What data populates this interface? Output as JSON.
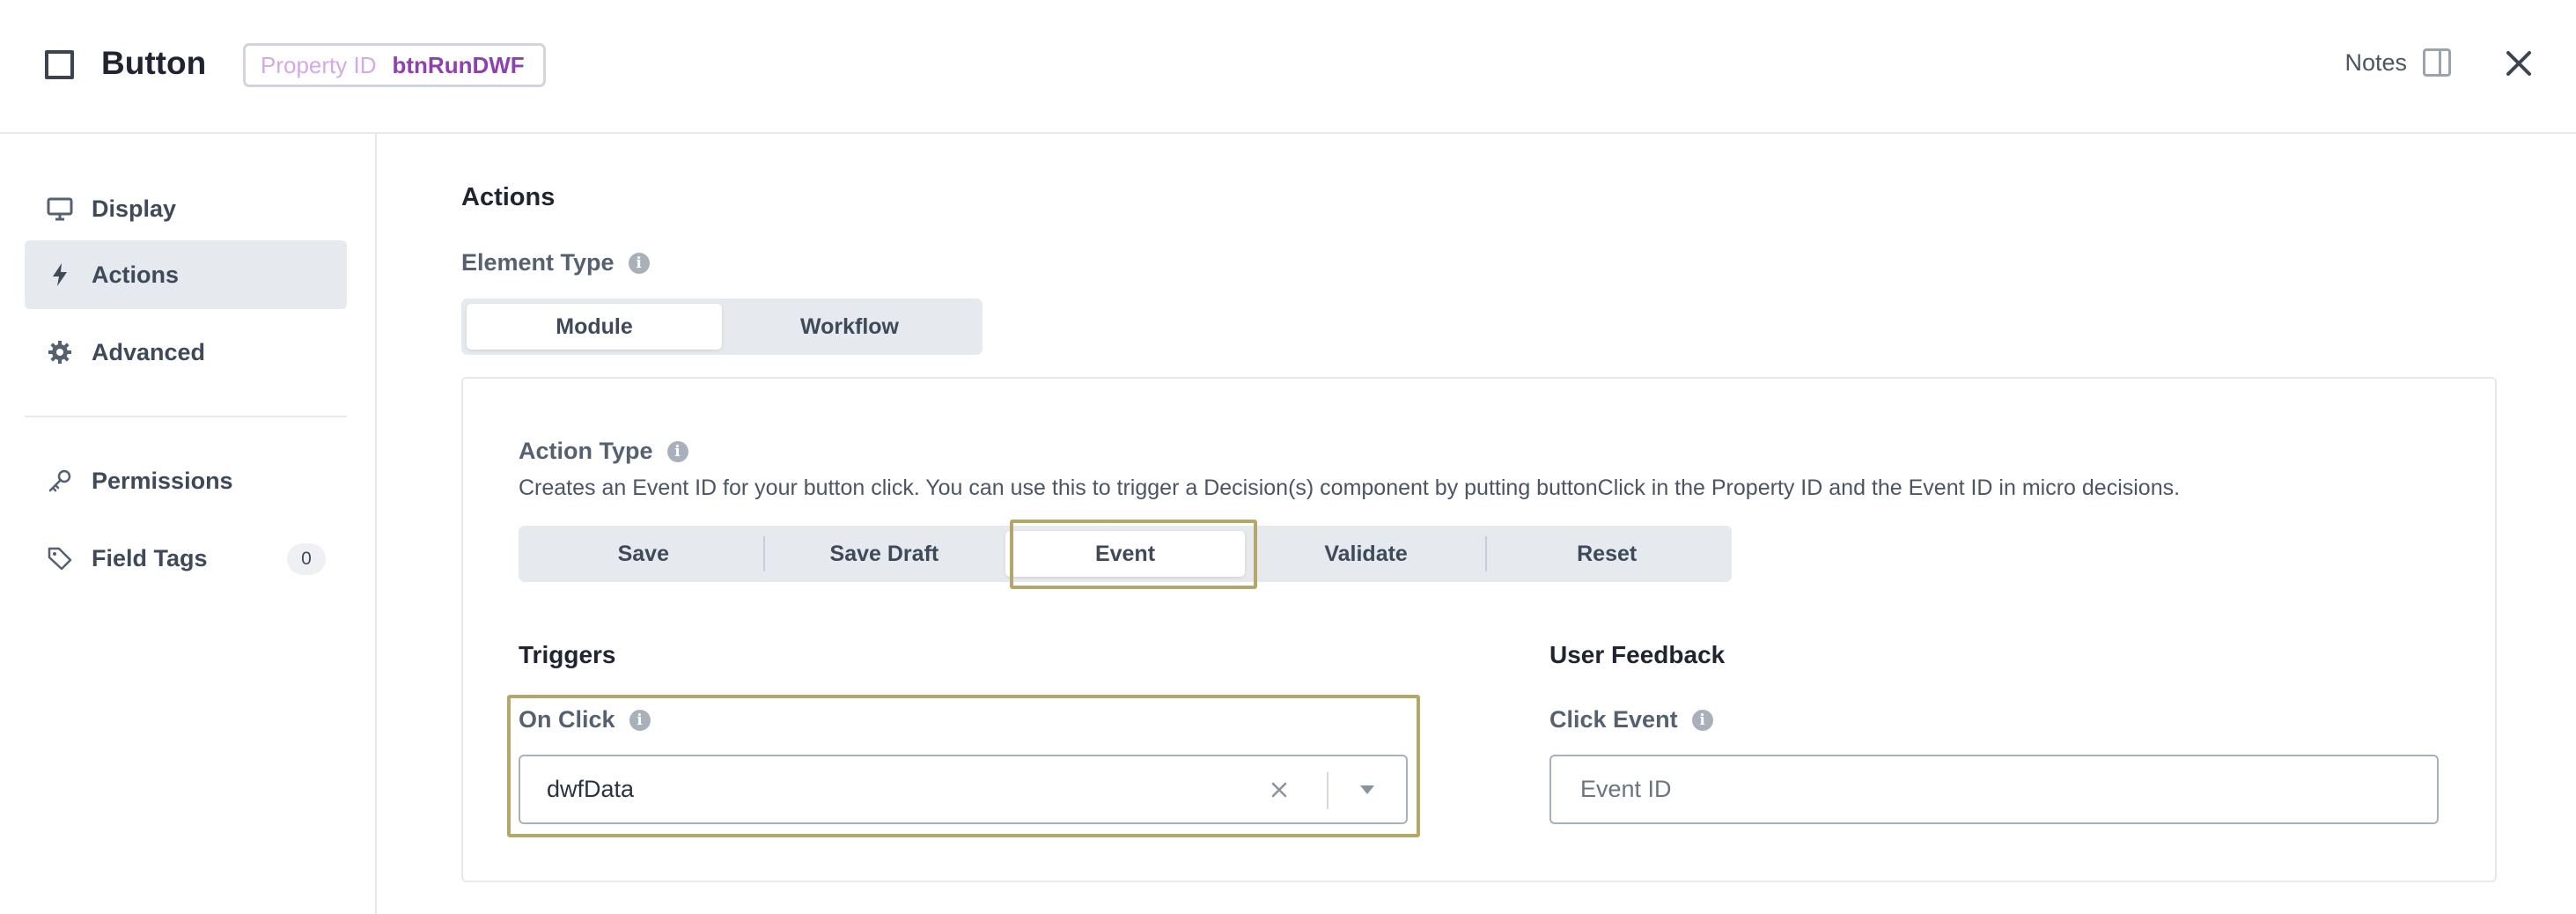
{
  "header": {
    "title": "Button",
    "property_id_label": "Property ID",
    "property_id_value": "btnRunDWF",
    "notes_label": "Notes"
  },
  "sidebar": {
    "items": [
      {
        "label": "Display",
        "icon": "monitor-icon"
      },
      {
        "label": "Actions",
        "icon": "bolt-icon",
        "active": true
      },
      {
        "label": "Advanced",
        "icon": "gear-icon"
      },
      {
        "label": "Permissions",
        "icon": "key-icon"
      },
      {
        "label": "Field Tags",
        "icon": "tag-icon",
        "count": "0"
      }
    ]
  },
  "main": {
    "title": "Actions",
    "element_type": {
      "label": "Element Type",
      "options": [
        "Module",
        "Workflow"
      ],
      "selected": "Module"
    },
    "action_type": {
      "label": "Action Type",
      "description": "Creates an Event ID for your button click. You can use this to trigger a Decision(s) component by putting buttonClick in the Property ID and the Event ID in micro decisions.",
      "options": [
        "Save",
        "Save Draft",
        "Event",
        "Validate",
        "Reset"
      ],
      "selected": "Event"
    },
    "triggers": {
      "title": "Triggers",
      "on_click_label": "On Click",
      "on_click_value": "dwfData"
    },
    "user_feedback": {
      "title": "User Feedback",
      "click_event_label": "Click Event",
      "click_event_placeholder": "Event ID",
      "click_event_value": ""
    }
  },
  "colors": {
    "highlight": "#b5a66a",
    "property_id_label": "#d5a8e8",
    "property_id_value": "#8e3fb0",
    "active_bg": "#e6e9ee"
  }
}
